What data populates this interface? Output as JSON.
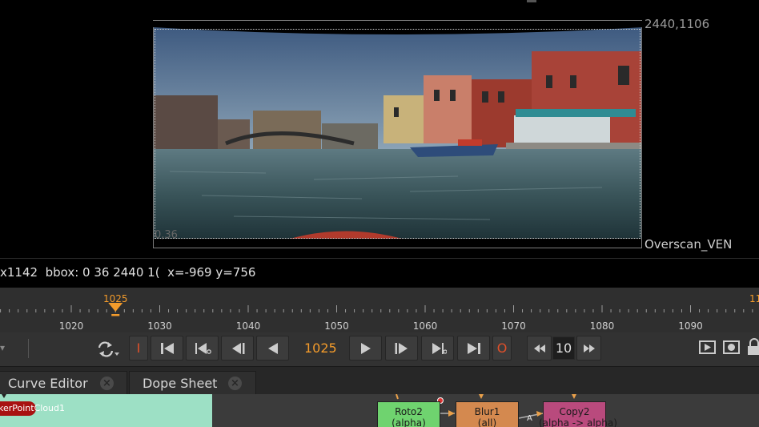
{
  "viewer": {
    "resolution_label": "2440,1106",
    "format_label": "Overscan_VEN",
    "origin_label": "0,36"
  },
  "infobar": {
    "text": "x1142  bbox: 0 36 2440 1(  x=-969 y=756"
  },
  "timeline": {
    "current_frame_marker": "1025",
    "end_frame_marker_partial": "11",
    "tick_labels": [
      "1020",
      "1030",
      "1040",
      "1050",
      "1060",
      "1070",
      "1080",
      "1090"
    ],
    "first_labeled_frame": 1020,
    "frame_step": 10,
    "playhead_frame": 1025
  },
  "transport": {
    "in_point_label": "I",
    "out_point_label": "O",
    "current_frame": "1025",
    "increment": "10",
    "icons": [
      "menu-icon",
      "loop-icon",
      "go-to-start-icon",
      "prev-keyframe-icon",
      "step-back-icon",
      "play-backward-icon",
      "play-forward-icon",
      "step-forward-icon",
      "next-keyframe-icon",
      "go-to-end-icon",
      "skip-back-icon",
      "skip-forward-icon",
      "flipbook-icon",
      "record-icon",
      "lock-icon"
    ]
  },
  "tabs": [
    {
      "label": "Curve Editor"
    },
    {
      "label": "Dope Sheet"
    }
  ],
  "nodegraph": {
    "tracker_node": "kerPointCloud1",
    "nodes": [
      {
        "name": "Roto2",
        "sub": "(alpha)",
        "color": "#6fd36f"
      },
      {
        "name": "Blur1",
        "sub": "(all)",
        "color": "#d4894f"
      },
      {
        "name": "Copy2",
        "sub": "(alpha -> alpha)",
        "color": "#b94a7d"
      }
    ],
    "pipe_label": "A"
  },
  "colors": {
    "accent": "#f39b2b",
    "in_out": "#e0502a",
    "dope_panel": "#9de0c5",
    "tracker_node": "#a81111"
  }
}
